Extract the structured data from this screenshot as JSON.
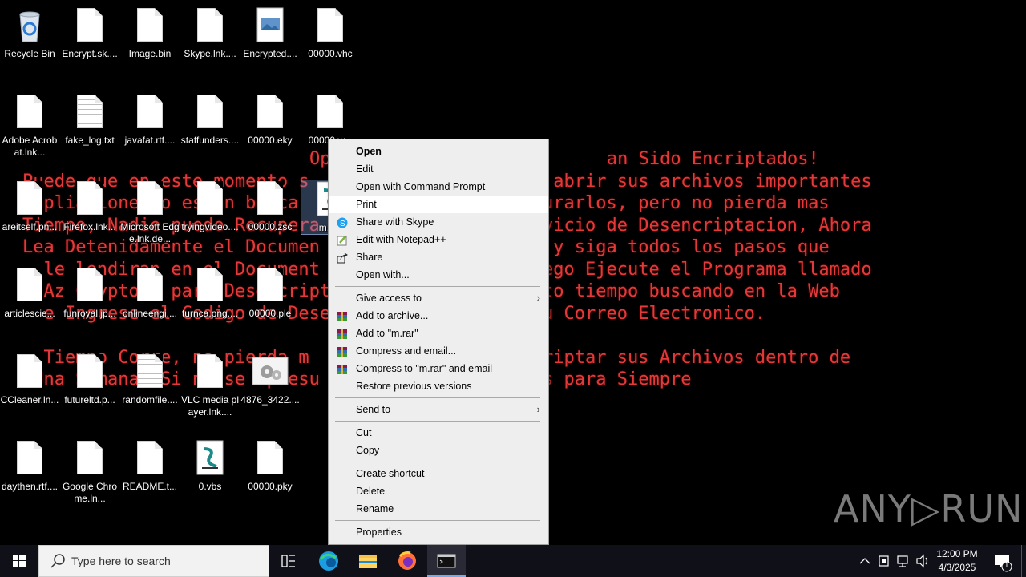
{
  "desktop": {
    "icons": [
      {
        "label": "Recycle Bin",
        "icon": "recycle-bin-icon"
      },
      {
        "label": "Encrypt.sk....",
        "icon": "file-icon"
      },
      {
        "label": "Image.bin",
        "icon": "file-icon"
      },
      {
        "label": "Skype.lnk....",
        "icon": "file-icon"
      },
      {
        "label": "Encrypted....",
        "icon": "image-file-icon"
      },
      {
        "label": "00000.vhc",
        "icon": "file-icon"
      },
      {
        "label": "Adobe Acrobat.lnk...",
        "icon": "file-icon"
      },
      {
        "label": "fake_log.txt",
        "icon": "text-file-icon"
      },
      {
        "label": "javafat.rtf....",
        "icon": "file-icon"
      },
      {
        "label": "staffunders....",
        "icon": "file-icon"
      },
      {
        "label": "00000.eky",
        "icon": "file-icon"
      },
      {
        "label": "00000.w...",
        "icon": "file-icon"
      },
      {
        "label": "areitself.pn...",
        "icon": "file-icon"
      },
      {
        "label": "Firefox.lnk...",
        "icon": "file-icon"
      },
      {
        "label": "Microsoft Edge.lnk.de...",
        "icon": "file-icon"
      },
      {
        "label": "tryingvideo....",
        "icon": "file-icon"
      },
      {
        "label": "00000.zsc",
        "icon": "file-icon"
      },
      {
        "label": "m.v...",
        "icon": "script-file-icon"
      },
      {
        "label": "articlescie...",
        "icon": "file-icon"
      },
      {
        "label": "funroyal.jp...",
        "icon": "file-icon"
      },
      {
        "label": "onlineengi....",
        "icon": "file-icon"
      },
      {
        "label": "turnca.png....",
        "icon": "file-icon"
      },
      {
        "label": "00000.ple",
        "icon": "file-icon"
      },
      {
        "label": "CCleaner.ln...",
        "icon": "file-icon"
      },
      {
        "label": "futureltd.p...",
        "icon": "file-icon"
      },
      {
        "label": "randomfile....",
        "icon": "text-file-icon"
      },
      {
        "label": "VLC media player.lnk....",
        "icon": "file-icon"
      },
      {
        "label": "4876_3422....",
        "icon": "settings-file-icon"
      },
      {
        "label": "daythen.rtf....",
        "icon": "file-icon"
      },
      {
        "label": "Google Chrome.ln...",
        "icon": "file-icon"
      },
      {
        "label": "README.t...",
        "icon": "file-icon"
      },
      {
        "label": "0.vbs",
        "icon": "script-file-icon"
      },
      {
        "label": "00000.pky",
        "icon": "file-icon"
      }
    ],
    "wallpaper_lines": [
      "Op                          an Sido Encriptados!",
      "Puede que en este momento s          que no puede abrir sus archivos importantes",
      "Anpliaciones o estan busca          irlos o restaurarlos, pero no pierda mas",
      "Tiempo, Nadie puede Recupera          Nuestro Servicio de Desencriptacion, Ahora",
      "Lea Detenidamente el Documen         \"README.txt\" y siga todos los pasos que",
      "  le lendiran en el Document          Busque y luego Ejecute el Programa llamado",
      "  Az Crypton\" para Desencript          perder tanto tiempo buscando en la Web",
      "  e Ingrese el Codigo de Desen          pio por su Correo Electronico.",
      "",
      "  Tiempo Corre, no pierda m          podra desencriptar sus Archivos dentro de",
      " Una Semana, Si no se apresu          sus Archivos para Siempre"
    ],
    "wallpaper_color": "#e23a3a"
  },
  "context_menu": {
    "items": [
      {
        "label": "Open",
        "bold": true
      },
      {
        "label": "Edit"
      },
      {
        "label": "Open with Command Prompt"
      },
      {
        "label": "Print",
        "hover": true
      },
      {
        "label": "Share with Skype",
        "icon": "skype-icon"
      },
      {
        "label": "Edit with Notepad++",
        "icon": "notepad-plus-plus-icon"
      },
      {
        "label": "Share",
        "icon": "share-icon"
      },
      {
        "label": "Open with..."
      },
      {
        "separator": true
      },
      {
        "label": "Give access to",
        "submenu": true
      },
      {
        "label": "Add to archive...",
        "icon": "winrar-icon"
      },
      {
        "label": "Add to \"m.rar\"",
        "icon": "winrar-icon"
      },
      {
        "label": "Compress and email...",
        "icon": "winrar-icon"
      },
      {
        "label": "Compress to \"m.rar\" and email",
        "icon": "winrar-icon"
      },
      {
        "label": "Restore previous versions"
      },
      {
        "separator": true
      },
      {
        "label": "Send to",
        "submenu": true
      },
      {
        "separator": true
      },
      {
        "label": "Cut"
      },
      {
        "label": "Copy"
      },
      {
        "separator": true
      },
      {
        "label": "Create shortcut"
      },
      {
        "label": "Delete"
      },
      {
        "label": "Rename"
      },
      {
        "separator": true
      },
      {
        "label": "Properties"
      }
    ]
  },
  "taskbar": {
    "search_placeholder": "Type here to search",
    "time": "12:00 PM",
    "date": "4/3/2025",
    "notification_count": "1",
    "pinned": [
      "task-view-icon",
      "edge-icon",
      "file-explorer-icon",
      "firefox-icon",
      "terminal-icon"
    ]
  },
  "watermark": "ANY▷RUN"
}
